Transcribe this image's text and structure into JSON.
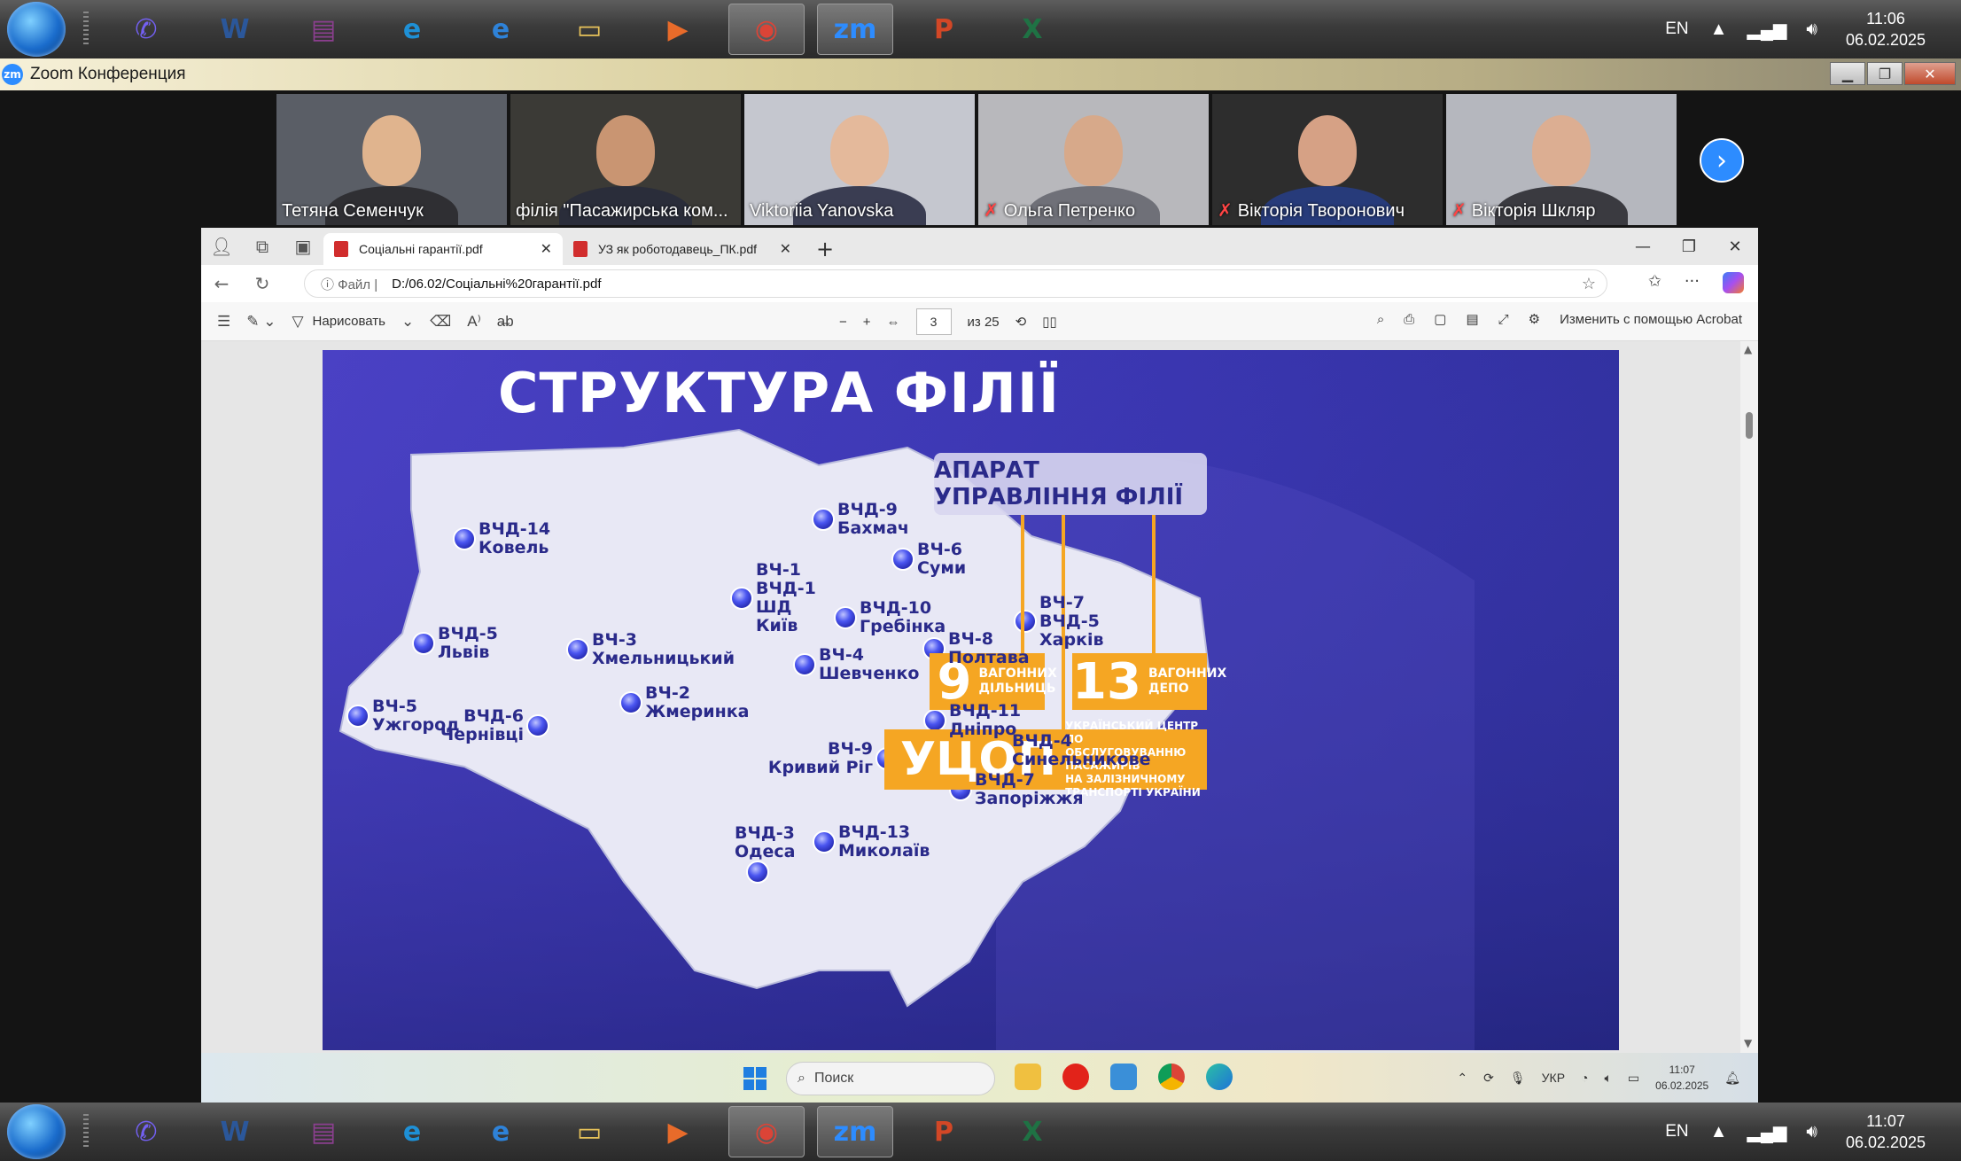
{
  "os_taskbar": {
    "language": "EN",
    "top_clock": {
      "time": "11:06",
      "date": "06.02.2025"
    },
    "bottom_clock": {
      "time": "11:07",
      "date": "06.02.2025"
    },
    "apps": [
      {
        "name": "viber",
        "glyph": "✆",
        "color": "#7360f2"
      },
      {
        "name": "word",
        "glyph": "W",
        "color": "#2b579a"
      },
      {
        "name": "winrar",
        "glyph": "▤",
        "color": "#8b3f8f"
      },
      {
        "name": "edge",
        "glyph": "e",
        "color": "#1e90d6"
      },
      {
        "name": "internet-explorer",
        "glyph": "e",
        "color": "#2e82d8"
      },
      {
        "name": "file-explorer",
        "glyph": "▭",
        "color": "#e8c35a"
      },
      {
        "name": "media-player",
        "glyph": "▶",
        "color": "#e86b2a"
      },
      {
        "name": "chrome",
        "glyph": "◉",
        "color": "#db4437"
      },
      {
        "name": "zoom",
        "glyph": "zm",
        "color": "#2d8cff"
      },
      {
        "name": "powerpoint",
        "glyph": "P",
        "color": "#d24726"
      },
      {
        "name": "excel",
        "glyph": "X",
        "color": "#1f7244"
      }
    ]
  },
  "zoom": {
    "window_title": "Zoom Конференция",
    "logo": "zm",
    "participants": [
      {
        "name": "Тетяна Семенчук",
        "muted": false,
        "bg": "#5a5e66",
        "skin": "#e0b48e",
        "shirt": "#2f2f33"
      },
      {
        "name": "філія \"Пасажирська ком...",
        "muted": false,
        "bg": "#3b3a36",
        "skin": "#c99572",
        "shirt": "#2a2d3a"
      },
      {
        "name": "Viktoriia Yanovska",
        "muted": false,
        "bg": "#c5c7cf",
        "skin": "#e4b99b",
        "shirt": "#3a3d52"
      },
      {
        "name": "Ольга Петренко",
        "muted": true,
        "bg": "#b8b8bc",
        "skin": "#d7a98a",
        "shirt": "#6f7078"
      },
      {
        "name": "Вікторія Творонович",
        "muted": true,
        "bg": "#2d2d2d",
        "skin": "#d6a185",
        "shirt": "#273b7a"
      },
      {
        "name": "Вікторія Шкляр",
        "muted": true,
        "bg": "#b5b7be",
        "skin": "#dcae92",
        "shirt": "#3a3a40"
      }
    ]
  },
  "browser": {
    "tabs": [
      {
        "title": "Соціальні гарантії.pdf",
        "active": true
      },
      {
        "title": "УЗ як роботодавець_ПК.pdf",
        "active": false
      }
    ],
    "address": {
      "scheme_label": "Файл",
      "url": "D:/06.02/Соціальні%20гарантії.pdf"
    },
    "pdf_toolbar": {
      "draw_label": "Нарисовать",
      "current_page": "3",
      "total_pages": "из 25",
      "edit_label": "Изменить с помощью Acrobat"
    }
  },
  "slide": {
    "title": "СТРУКТУРА ФІЛІЇ",
    "management_box": "АПАРАТ УПРАВЛІННЯ ФІЛІЇ",
    "stat1": {
      "number": "9",
      "label": "ВАГОННИХ ДІЛЬНИЦЬ"
    },
    "stat2": {
      "number": "13",
      "label": "ВАГОННИХ ДЕПО"
    },
    "ucop": {
      "abbr": "УЦОП",
      "line1": "УКРАЇНСЬКИЙ ЦЕНТР",
      "line2": "ПО ОБСЛУГОВУВАННЮ ПАСАЖИРІВ",
      "line3": "НА ЗАЛІЗНИЧНОМУ ТРАНСПОРТІ УКРАЇНИ"
    },
    "depots": [
      {
        "lines": [
          "ВЧД-14",
          "Ковель"
        ],
        "side": "right"
      },
      {
        "lines": [
          "ВЧД-9",
          "Бахмач"
        ],
        "side": "right"
      },
      {
        "lines": [
          "ВЧ-1",
          "ВЧД-1",
          "ШД",
          "Київ"
        ],
        "side": "right"
      },
      {
        "lines": [
          "ВЧ-6",
          "Суми"
        ],
        "side": "right"
      },
      {
        "lines": [
          "ВЧД-10",
          "Гребінка"
        ],
        "side": "right"
      },
      {
        "lines": [
          "ВЧ-7",
          "ВЧД-5",
          "Харків"
        ],
        "side": "right"
      },
      {
        "lines": [
          "ВЧД-5",
          "Львів"
        ],
        "side": "right"
      },
      {
        "lines": [
          "ВЧ-3",
          "Хмельницький"
        ],
        "side": "right"
      },
      {
        "lines": [
          "ВЧ-4",
          "Шевченко"
        ],
        "side": "right"
      },
      {
        "lines": [
          "ВЧ-8",
          "Полтава"
        ],
        "side": "right"
      },
      {
        "lines": [
          "ВЧ-5",
          "Ужгород"
        ],
        "side": "right"
      },
      {
        "lines": [
          "ВЧД-6",
          "Чернівці"
        ],
        "side": "left"
      },
      {
        "lines": [
          "ВЧ-2",
          "Жмеринка"
        ],
        "side": "right"
      },
      {
        "lines": [
          "ВЧД-11",
          "Дніпро"
        ],
        "side": "right"
      },
      {
        "lines": [
          "ВЧД-4",
          "Синельникове"
        ],
        "side": "right"
      },
      {
        "lines": [
          "ВЧ-9",
          "Кривий Ріг"
        ],
        "side": "left"
      },
      {
        "lines": [
          "ВЧД-7",
          "Запоріжжя"
        ],
        "side": "right"
      },
      {
        "lines": [
          "ВЧД-3",
          "Одеса"
        ],
        "side": "above"
      },
      {
        "lines": [
          "ВЧД-13",
          "Миколаїв"
        ],
        "side": "right"
      }
    ]
  },
  "win_taskbar": {
    "search_placeholder": "Поиск",
    "language": "УКР",
    "clock": {
      "time": "11:07",
      "date": "06.02.2025"
    }
  }
}
